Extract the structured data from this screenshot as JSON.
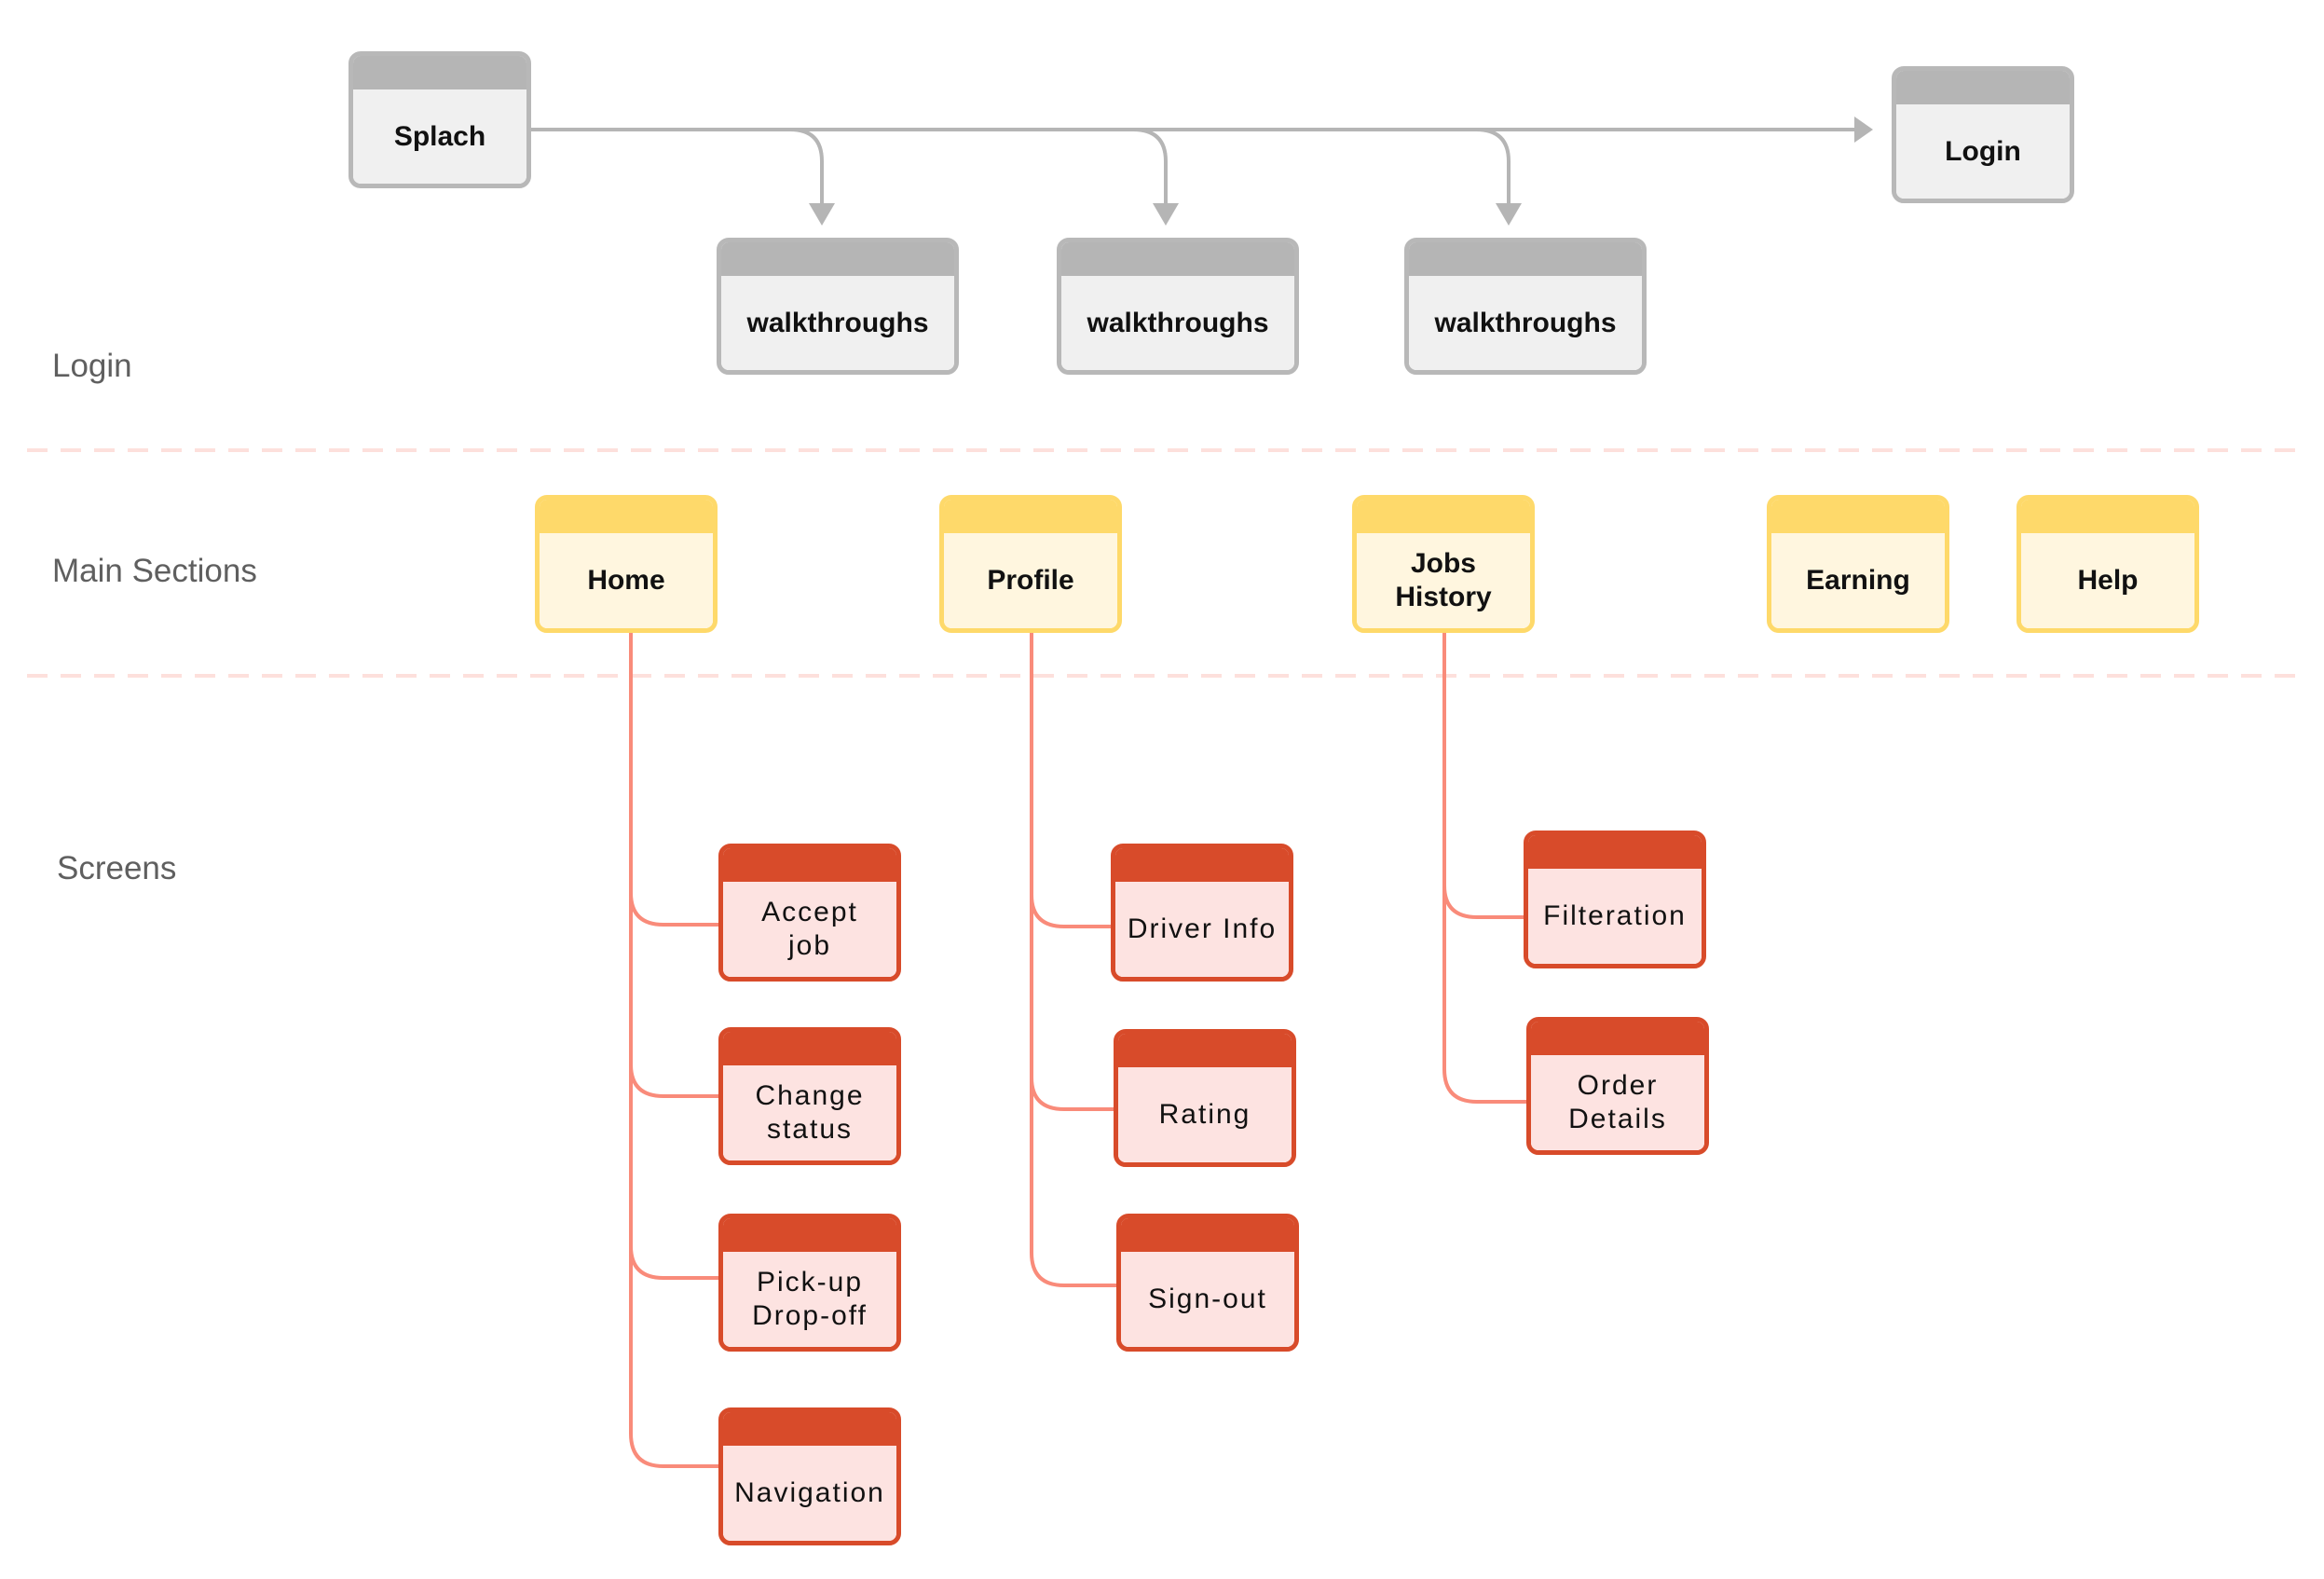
{
  "lanes": {
    "login": "Login",
    "main_sections": "Main Sections",
    "screens": "Screens"
  },
  "login_flow": {
    "splash": "Splach",
    "walkthroughs": [
      "walkthroughs",
      "walkthroughs",
      "walkthroughs"
    ],
    "login": "Login"
  },
  "main_sections": [
    "Home",
    "Profile",
    "Jobs\nHistory",
    "Earning",
    "Help"
  ],
  "screens": {
    "home": [
      "Accept\njob",
      "Change\nstatus",
      "Pick-up\nDrop-off",
      "Navigation"
    ],
    "profile": [
      "Driver Info",
      "Rating",
      "Sign-out"
    ],
    "jobs_history": [
      "Filteration",
      "Order\nDetails"
    ]
  },
  "colors": {
    "login_header": "#b5b5b5",
    "login_body": "#f0f0f0",
    "section_header": "#fed96a",
    "section_body": "#fff6df",
    "screen_header": "#d84b2a",
    "screen_body": "#fde3e1",
    "connector": "#f98b7a",
    "flow_arrow": "#b5b5b5",
    "lane_divider": "#fde0dc"
  }
}
